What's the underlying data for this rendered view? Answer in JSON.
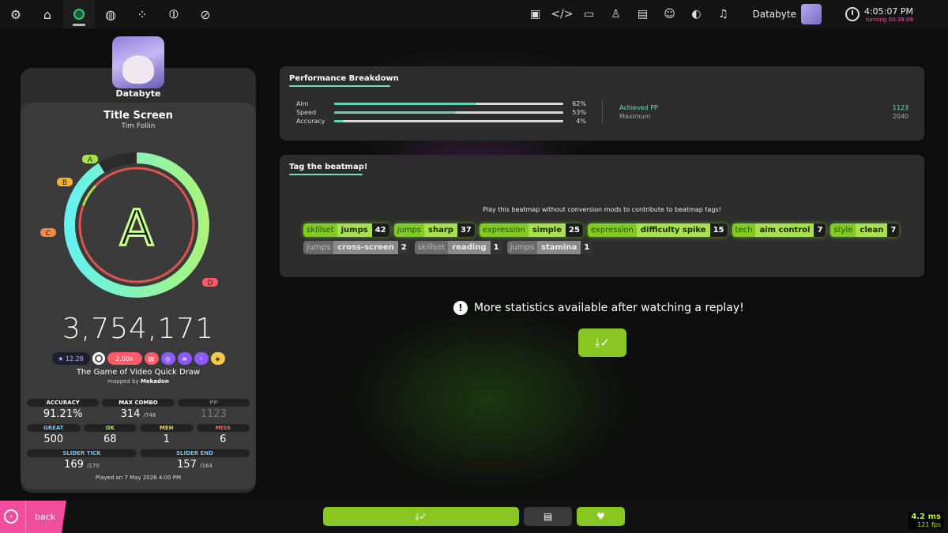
{
  "toolbar": {
    "left_icons": [
      "settings-icon",
      "home-icon",
      "osu-ruleset-icon",
      "taiko-ruleset-icon",
      "catch-ruleset-icon",
      "mania-ruleset-icon",
      "tools-icon"
    ],
    "right_icons": [
      "news-icon",
      "code-icon",
      "beatmap-listing-icon",
      "rankings-icon",
      "changelog-icon",
      "chat-icon",
      "world-icon",
      "music-icon"
    ],
    "username": "Databyte",
    "clock_time": "4:05:07 PM",
    "clock_running": "running 00:39:09"
  },
  "score_panel": {
    "player": "Databyte",
    "title": "Title Screen",
    "artist": "Tim Follin",
    "rank": "A",
    "rank_labels": [
      "A",
      "B",
      "C",
      "D"
    ],
    "score": "3,754,171",
    "star_rating": "★ 12.28",
    "rate_mod": "2.00x",
    "difficulty": "The Game of Video Quick Draw",
    "mapped_by_prefix": "mapped by",
    "mapper": "Mekadon",
    "accuracy_label": "ACCURACY",
    "accuracy": "91.21%",
    "max_combo_label": "MAX COMBO",
    "max_combo": "314",
    "max_combo_total": "/746",
    "pp_label": "PP",
    "pp": "1123",
    "great_label": "GREAT",
    "great": "500",
    "ok_label": "OK",
    "ok": "68",
    "meh_label": "MEH",
    "meh": "1",
    "miss_label": "MISS",
    "miss": "6",
    "slider_tick_label": "SLIDER TICK",
    "slider_tick": "169",
    "slider_tick_total": "/170",
    "slider_end_label": "SLIDER END",
    "slider_end": "157",
    "slider_end_total": "/164",
    "played_on": "Played on 7 May 2026 4:00 PM",
    "accuracy_fraction": 0.9121,
    "colors": {
      "ring_cyan": "#66f2ee",
      "ring_green": "#a8f47c",
      "great": "#66c7ff",
      "ok": "#a8e24a",
      "meh": "#f2c94c",
      "miss": "#ff5a6a",
      "rank_a": "#a8f47c"
    }
  },
  "performance": {
    "title": "Performance Breakdown",
    "bars": [
      {
        "label": "Aim",
        "value": 0.62,
        "percent": "62%"
      },
      {
        "label": "Speed",
        "value": 0.53,
        "percent": "53%"
      },
      {
        "label": "Accuracy",
        "value": 0.04,
        "percent": "4%"
      }
    ],
    "achieved_pp_label": "Achieved PP",
    "achieved_pp": "1123",
    "maximum_label": "Maximum",
    "maximum": "2040"
  },
  "tags": {
    "title": "Tag the beatmap!",
    "hint": "Play this beatmap without conversion mods to contribute to beatmap tags!",
    "row1": [
      {
        "category": "skillset",
        "name": "jumps",
        "count": "42"
      },
      {
        "category": "jumps",
        "name": "sharp",
        "count": "37"
      },
      {
        "category": "expression",
        "name": "simple",
        "count": "25"
      },
      {
        "category": "expression",
        "name": "difficulty spike",
        "count": "15"
      },
      {
        "category": "tech",
        "name": "aim control",
        "count": "7"
      },
      {
        "category": "style",
        "name": "clean",
        "count": "7"
      }
    ],
    "row2": [
      {
        "category": "jumps",
        "name": "cross-screen",
        "count": "2"
      },
      {
        "category": "skillset",
        "name": "reading",
        "count": "1"
      },
      {
        "category": "jumps",
        "name": "stamina",
        "count": "1"
      }
    ]
  },
  "replay": {
    "message": "More statistics available after watching a replay!"
  },
  "footer": {
    "back_label": "back",
    "latency": "4.2 ms",
    "fps": "121 fps"
  }
}
